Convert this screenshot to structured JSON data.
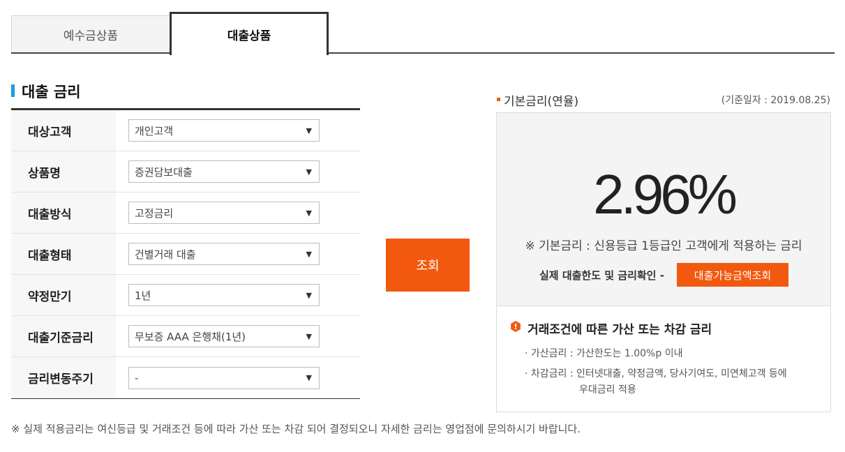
{
  "tabs": [
    {
      "label": "예수금상품",
      "active": false
    },
    {
      "label": "대출상품",
      "active": true
    }
  ],
  "section_title": "대출 금리",
  "form": {
    "rows": [
      {
        "label": "대상고객",
        "value": "개인고객"
      },
      {
        "label": "상품명",
        "value": "증권담보대출"
      },
      {
        "label": "대출방식",
        "value": "고정금리"
      },
      {
        "label": "대출형태",
        "value": "건별거래 대출"
      },
      {
        "label": "약정만기",
        "value": "1년"
      },
      {
        "label": "대출기준금리",
        "value": "무보증 AAA 은행채(1년)"
      },
      {
        "label": "금리변동주기",
        "value": "-"
      }
    ]
  },
  "search_button": "조회",
  "rate_panel": {
    "title": "기본금리(연율)",
    "date": "(기준일자 : 2019.08.25)",
    "value": "2.96%",
    "note": "※ 기본금리 : 신용등급 1등급인 고객에게 적용하는 금리",
    "check_text": "실제 대출한도 및 금리확인 -",
    "inquiry_button": "대출가능금액조회",
    "conditions_title": "거래조건에 따른 가산 또는 차감 금리",
    "conditions_icon": "!",
    "add_rate": "· 가산금리 : 가산한도는 1.00%p 이내",
    "sub_rate_line1": "· 차감금리 : 인터넷대출, 약정금액, 당사기여도, 미연체고객 등에",
    "sub_rate_line2": "우대금리 적용"
  },
  "footnote": "※ 실제 적용금리는 여신등급 및 거래조건 등에 따라 가산 또는 차감 되어 결정되오니 자세한 금리는 영업점에 문의하시기 바랍니다.",
  "colors": {
    "accent": "#f2590f",
    "bar": "#1e9be0"
  }
}
